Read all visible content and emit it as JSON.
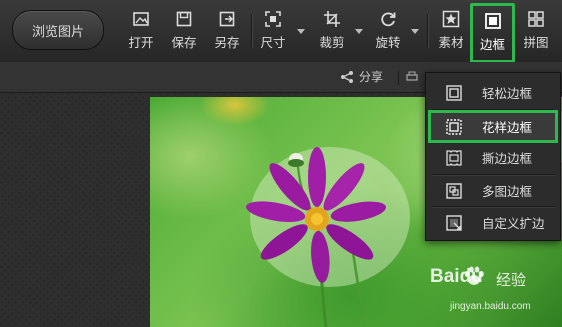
{
  "toolbar": {
    "browse_label": "浏览图片",
    "tools": {
      "open": "打开",
      "save": "保存",
      "save_as": "另存",
      "size": "尺寸",
      "crop": "裁剪",
      "rotate": "旋转",
      "material": "素材",
      "border": "边框",
      "collage": "拼图"
    },
    "accent_color": "#2db94d"
  },
  "subbar": {
    "share_label": "分享"
  },
  "border_menu": {
    "items": [
      {
        "label": "轻松边框",
        "icon": "simple-frame-icon"
      },
      {
        "label": "花样边框",
        "icon": "pattern-frame-icon",
        "highlighted": true
      },
      {
        "label": "撕边边框",
        "icon": "torn-frame-icon"
      },
      {
        "label": "多图边框",
        "icon": "multi-frame-icon"
      },
      {
        "label": "自定义扩边",
        "icon": "custom-expand-icon"
      }
    ]
  },
  "watermark": {
    "logo": "Baidu",
    "text": "经验",
    "url": "jingyan.baidu.com"
  }
}
